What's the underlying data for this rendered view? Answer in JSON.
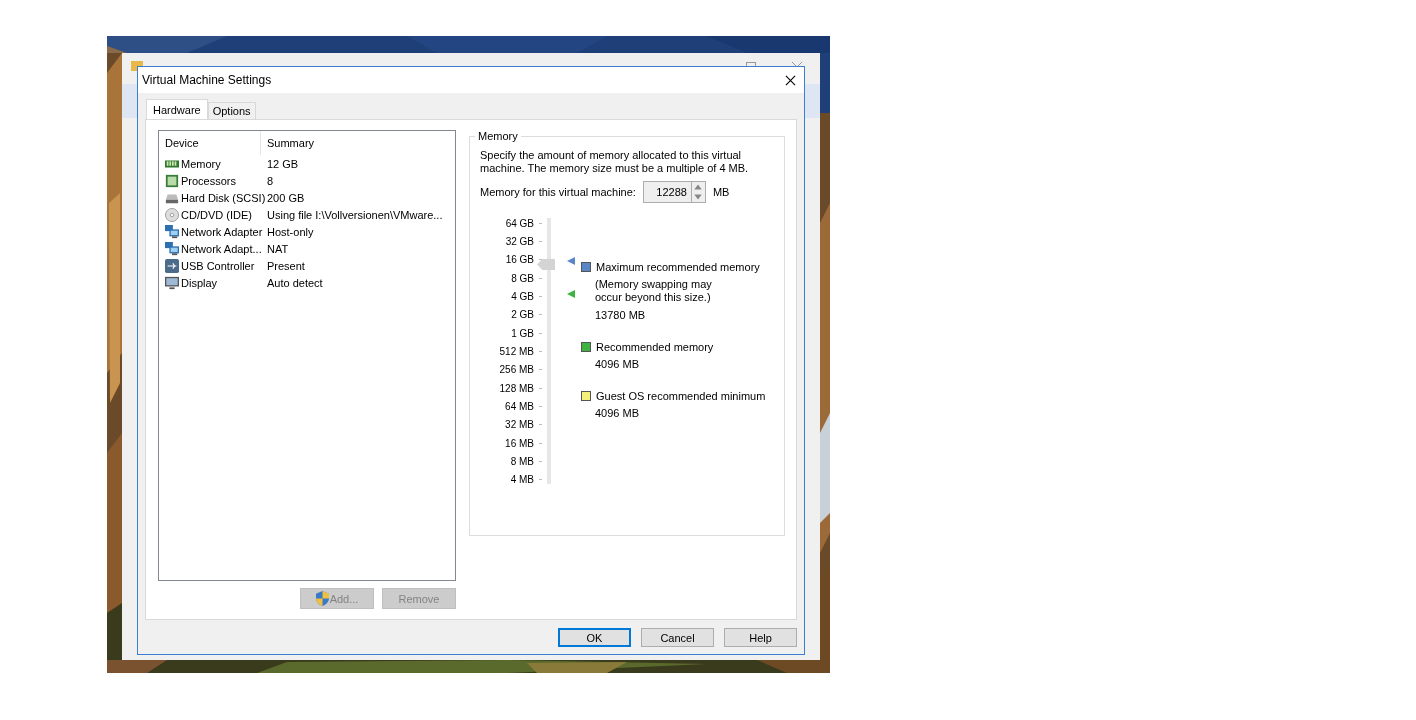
{
  "dialog": {
    "title": "Virtual Machine Settings"
  },
  "tabs": [
    {
      "label": "Hardware",
      "selected": true
    },
    {
      "label": "Options",
      "selected": false
    }
  ],
  "device_table": {
    "columns": [
      "Device",
      "Summary"
    ],
    "rows": [
      {
        "kind": "memory",
        "device": "Memory",
        "summary": "12 GB"
      },
      {
        "kind": "processor",
        "device": "Processors",
        "summary": "8"
      },
      {
        "kind": "disk",
        "device": "Hard Disk (SCSI)",
        "summary": "200 GB"
      },
      {
        "kind": "cd",
        "device": "CD/DVD (IDE)",
        "summary": "Using file I:\\Vollversionen\\VMware..."
      },
      {
        "kind": "network",
        "device": "Network Adapter",
        "summary": "Host-only"
      },
      {
        "kind": "network",
        "device": "Network Adapt...",
        "summary": "NAT"
      },
      {
        "kind": "usb",
        "device": "USB Controller",
        "summary": "Present"
      },
      {
        "kind": "display",
        "device": "Display",
        "summary": "Auto detect"
      }
    ]
  },
  "list_buttons": [
    {
      "label": "Add...",
      "disabled": true,
      "shield": true
    },
    {
      "label": "Remove",
      "disabled": true,
      "shield": false
    }
  ],
  "memory": {
    "group_title": "Memory",
    "description": "Specify the amount of memory allocated to this virtual machine. The memory size must be a multiple of 4 MB.",
    "field_label": "Memory for this virtual machine:",
    "value": "12288",
    "unit": "MB",
    "slider": {
      "level": 0.827,
      "markers": [
        {
          "level": 0.839,
          "color": "#5b86c6"
        },
        {
          "level": 0.714,
          "color": "#3fb23f"
        }
      ],
      "ticks": [
        "64 GB",
        "32 GB",
        "16 GB",
        "8 GB",
        "4 GB",
        "2 GB",
        "1 GB",
        "512 MB",
        "256 MB",
        "128 MB",
        "64 MB",
        "32 MB",
        "16 MB",
        "8 MB",
        "4 MB"
      ]
    },
    "legend": [
      {
        "label": "Maximum recommended memory",
        "note": "(Memory swapping may occur beyond this size.)",
        "value": "13780 MB",
        "color": "#5b86c6"
      },
      {
        "label": "Recommended memory",
        "value": "4096 MB",
        "color": "#3fb23f"
      },
      {
        "label": "Guest OS recommended minimum",
        "value": "4096 MB",
        "color": "#f4f07a"
      }
    ]
  },
  "footer_buttons": [
    {
      "label": "OK",
      "default": true
    },
    {
      "label": "Cancel",
      "default": false
    },
    {
      "label": "Help",
      "default": false
    }
  ]
}
